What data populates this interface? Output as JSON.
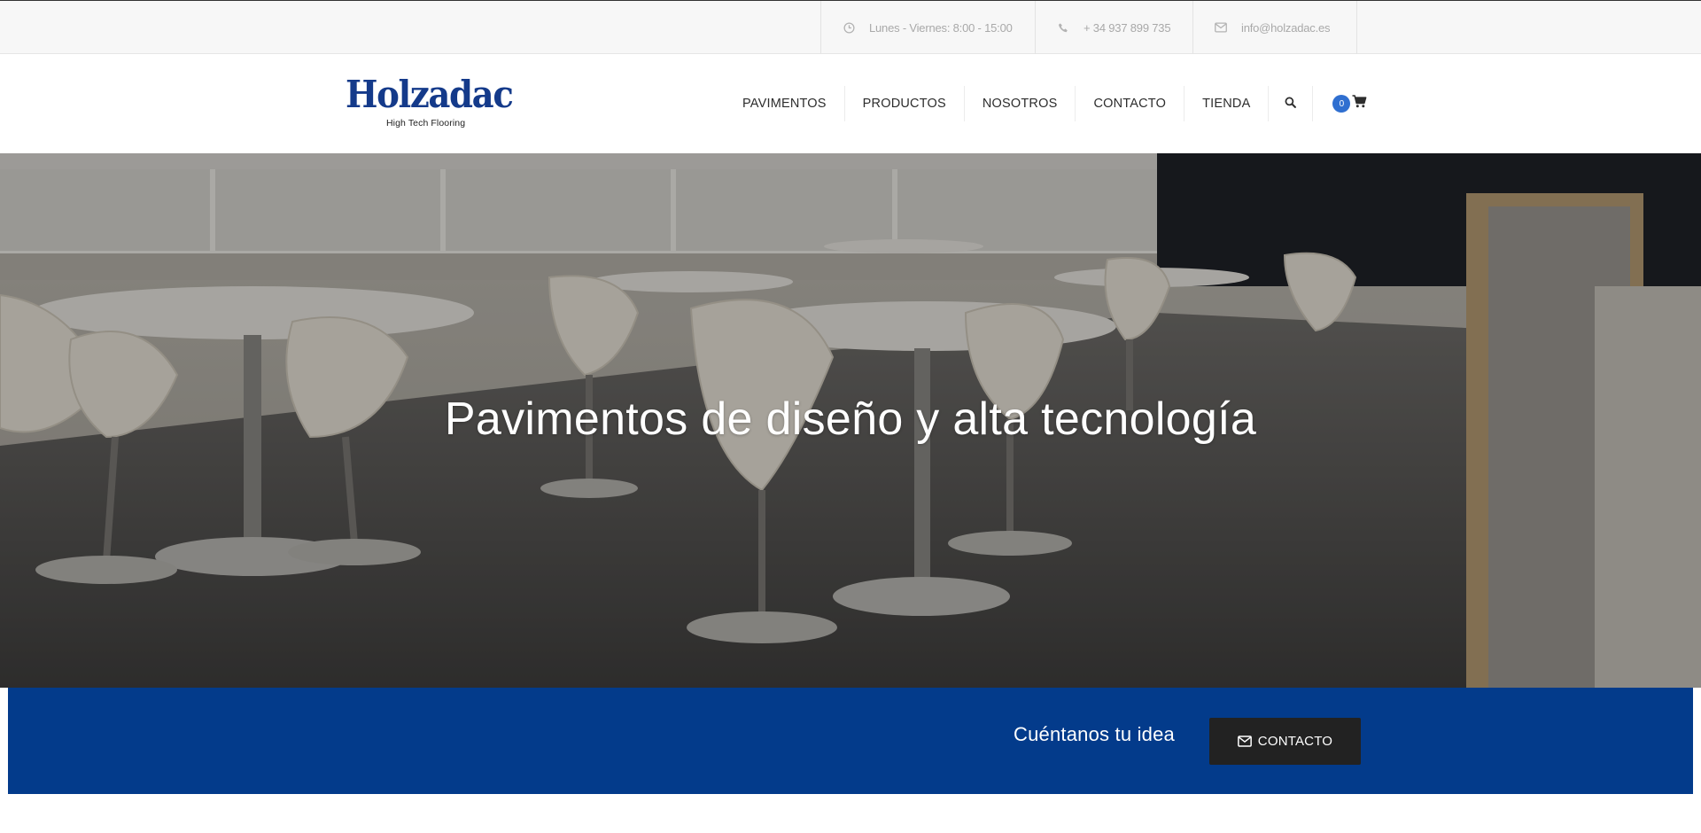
{
  "topbar": {
    "hours": "Lunes - Viernes: 8:00 - 15:00",
    "phone": "+ 34 937 899 735",
    "email": "info@holzadac.es",
    "icons": [
      "clock-icon",
      "phone-icon",
      "envelope-icon"
    ]
  },
  "brand": {
    "name": "Holzadac",
    "tagline": "High Tech Flooring",
    "color": "#143a8a"
  },
  "nav": {
    "items": [
      "PAVIMENTOS",
      "PRODUCTOS",
      "NOSOTROS",
      "CONTACTO",
      "TIENDA"
    ],
    "search_icon": "search-icon",
    "cart_icon": "shopping-cart-icon",
    "cart_count": "0"
  },
  "hero": {
    "title": "Pavimentos de diseño y alta tecnología"
  },
  "cta": {
    "text": "Cuéntanos tu idea",
    "button_label": "CONTACTO",
    "button_icon": "envelope-icon",
    "background": "#033b8b"
  }
}
